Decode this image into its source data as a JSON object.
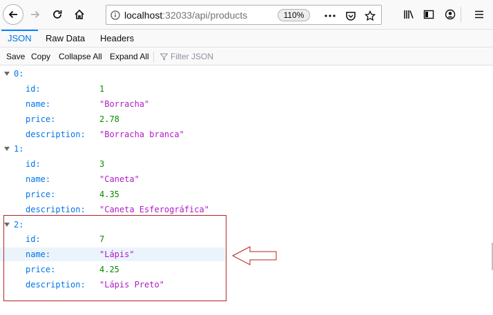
{
  "browser": {
    "url_host": "localhost",
    "url_rest": ":32033/api/products",
    "zoom": "110%"
  },
  "viewer": {
    "tabs": [
      {
        "label": "JSON",
        "active": true
      },
      {
        "label": "Raw Data",
        "active": false
      },
      {
        "label": "Headers",
        "active": false
      }
    ],
    "actions": {
      "save": "Save",
      "copy": "Copy",
      "collapse": "Collapse All",
      "expand": "Expand All",
      "filter_placeholder": "Filter JSON"
    }
  },
  "products": [
    {
      "index": "0:",
      "fields": [
        {
          "key": "id:",
          "value": "1",
          "type": "num"
        },
        {
          "key": "name:",
          "value": "\"Borracha\"",
          "type": "str"
        },
        {
          "key": "price:",
          "value": "2.78",
          "type": "num"
        },
        {
          "key": "description:",
          "value": "\"Borracha branca\"",
          "type": "str"
        }
      ]
    },
    {
      "index": "1:",
      "fields": [
        {
          "key": "id:",
          "value": "3",
          "type": "num"
        },
        {
          "key": "name:",
          "value": "\"Caneta\"",
          "type": "str"
        },
        {
          "key": "price:",
          "value": "4.35",
          "type": "num"
        },
        {
          "key": "description:",
          "value": "\"Caneta Esferográfica\"",
          "type": "str"
        }
      ]
    },
    {
      "index": "2:",
      "fields": [
        {
          "key": "id:",
          "value": "7",
          "type": "num"
        },
        {
          "key": "name:",
          "value": "\"Lápis\"",
          "type": "str"
        },
        {
          "key": "price:",
          "value": "4.25",
          "type": "num"
        },
        {
          "key": "description:",
          "value": "\"Lápis Preto\"",
          "type": "str"
        }
      ]
    }
  ],
  "colors": {
    "accent": "#0a84ff",
    "key": "#0074e8",
    "number": "#058b00",
    "string": "#b01ac7",
    "annotation": "#b22222"
  }
}
